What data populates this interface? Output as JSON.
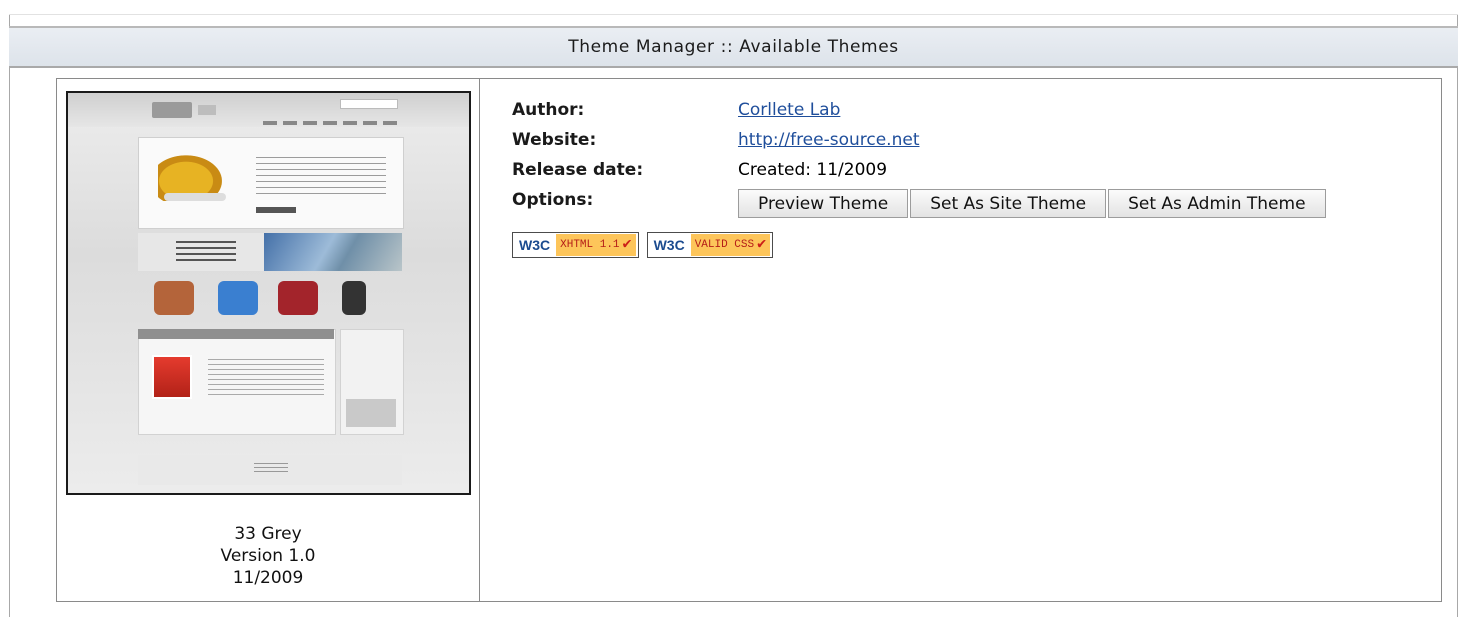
{
  "header": {
    "title": "Theme Manager :: Available Themes"
  },
  "theme": {
    "name": "33 Grey",
    "version": "Version 1.0",
    "date": "11/2009",
    "fields": {
      "author_label": "Author:",
      "author_value": "Corllete Lab",
      "website_label": "Website:",
      "website_value": "http://free-source.net",
      "release_label": "Release date:",
      "release_value": "Created: 11/2009",
      "options_label": "Options:"
    },
    "buttons": {
      "preview": "Preview Theme",
      "site": "Set As Site Theme",
      "admin": "Set As Admin Theme"
    },
    "badges": {
      "w3c": "W3C",
      "xhtml": "XHTML 1.1",
      "css": "VALID CSS",
      "check": "✔"
    }
  },
  "colors": {
    "link": "#1f4e9b",
    "badge_bg": "#fdc55a",
    "badge_text": "#b51e18"
  }
}
